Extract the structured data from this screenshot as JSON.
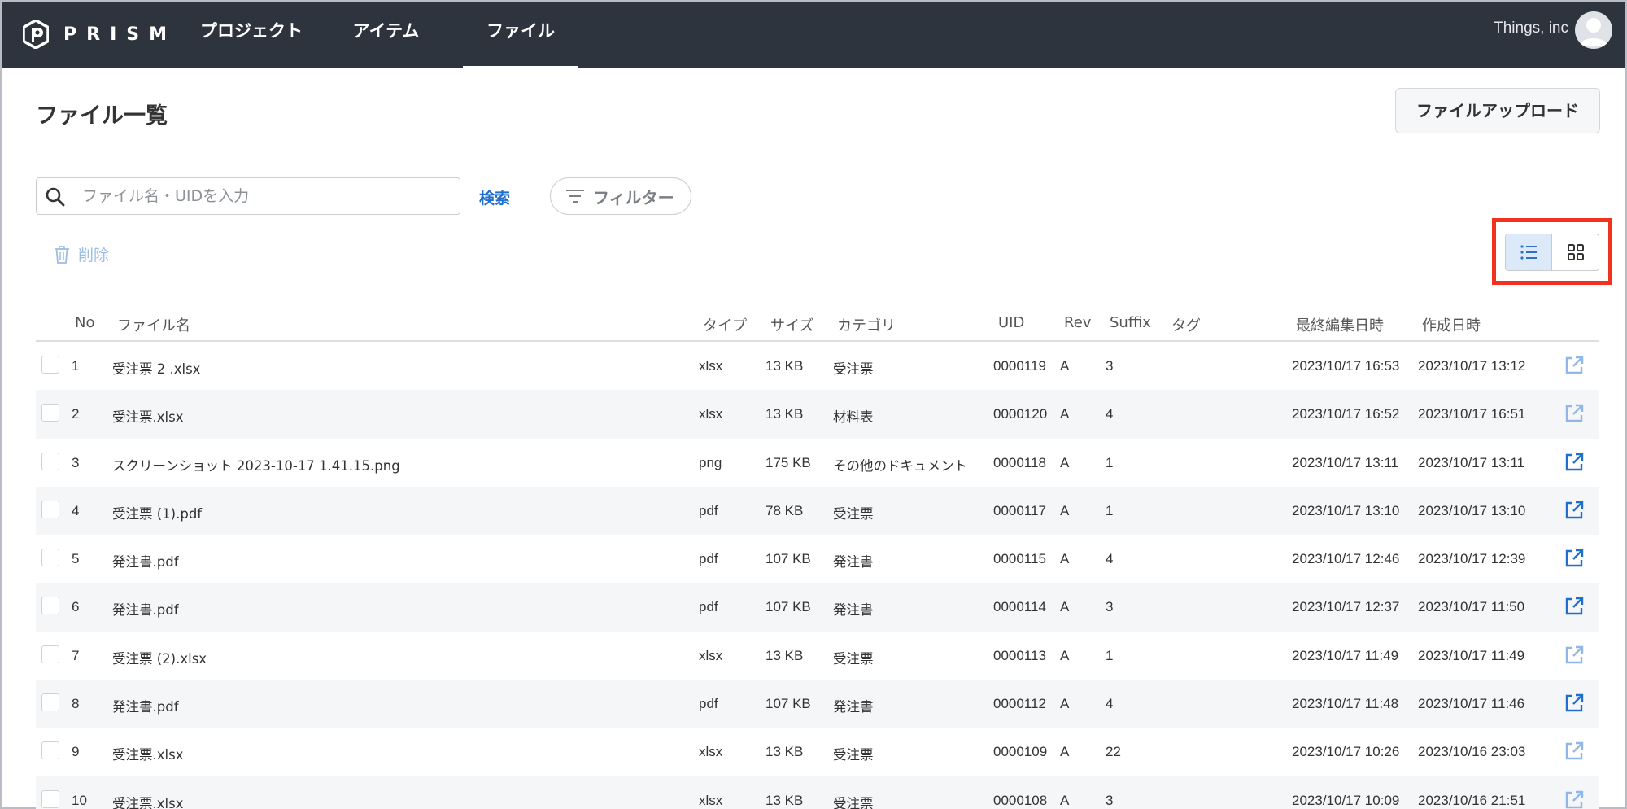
{
  "app": {
    "logo_text": "PRISM",
    "org_name": "Things, inc"
  },
  "nav": {
    "items": [
      {
        "label": "プロジェクト",
        "active": false
      },
      {
        "label": "アイテム",
        "active": false
      },
      {
        "label": "ファイル",
        "active": true
      }
    ]
  },
  "page": {
    "title": "ファイル一覧",
    "upload_label": "ファイルアップロード"
  },
  "search": {
    "placeholder": "ファイル名・UIDを入力",
    "value": "",
    "button_label": "検索",
    "filter_label": "フィルター"
  },
  "actions": {
    "delete_label": "削除"
  },
  "view_toggle": {
    "active": "list",
    "options": [
      "list-icon",
      "grid-icon"
    ]
  },
  "colors": {
    "nav_bg": "#2e343d",
    "accent": "#1f6fd0",
    "highlight": "#f0321e",
    "link_active": "#1f6fd0",
    "link_faded": "#8fb8e8"
  },
  "table": {
    "headers": {
      "no": "No",
      "name": "ファイル名",
      "type": "タイプ",
      "size": "サイズ",
      "category": "カテゴリ",
      "uid": "UID",
      "rev": "Rev",
      "suffix": "Suffix",
      "tag": "タグ",
      "updated": "最終編集日時",
      "created": "作成日時"
    },
    "rows": [
      {
        "no": "1",
        "name": "受注票 2 .xlsx",
        "type": "xlsx",
        "size": "13 KB",
        "category": "受注票",
        "uid": "0000119",
        "rev": "A",
        "suffix": "3",
        "tag": "",
        "updated": "2023/10/17 16:53",
        "created": "2023/10/17 13:12",
        "link_faded": true
      },
      {
        "no": "2",
        "name": "受注票.xlsx",
        "type": "xlsx",
        "size": "13 KB",
        "category": "材料表",
        "uid": "0000120",
        "rev": "A",
        "suffix": "4",
        "tag": "",
        "updated": "2023/10/17 16:52",
        "created": "2023/10/17 16:51",
        "link_faded": true
      },
      {
        "no": "3",
        "name": "スクリーンショット 2023-10-17 1.41.15.png",
        "type": "png",
        "size": "175 KB",
        "category": "その他のドキュメント",
        "uid": "0000118",
        "rev": "A",
        "suffix": "1",
        "tag": "",
        "updated": "2023/10/17 13:11",
        "created": "2023/10/17 13:11",
        "link_faded": false
      },
      {
        "no": "4",
        "name": "受注票 (1).pdf",
        "type": "pdf",
        "size": "78 KB",
        "category": "受注票",
        "uid": "0000117",
        "rev": "A",
        "suffix": "1",
        "tag": "",
        "updated": "2023/10/17 13:10",
        "created": "2023/10/17 13:10",
        "link_faded": false
      },
      {
        "no": "5",
        "name": "発注書.pdf",
        "type": "pdf",
        "size": "107 KB",
        "category": "発注書",
        "uid": "0000115",
        "rev": "A",
        "suffix": "4",
        "tag": "",
        "updated": "2023/10/17 12:46",
        "created": "2023/10/17 12:39",
        "link_faded": false
      },
      {
        "no": "6",
        "name": "発注書.pdf",
        "type": "pdf",
        "size": "107 KB",
        "category": "発注書",
        "uid": "0000114",
        "rev": "A",
        "suffix": "3",
        "tag": "",
        "updated": "2023/10/17 12:37",
        "created": "2023/10/17 11:50",
        "link_faded": false
      },
      {
        "no": "7",
        "name": "受注票 (2).xlsx",
        "type": "xlsx",
        "size": "13 KB",
        "category": "受注票",
        "uid": "0000113",
        "rev": "A",
        "suffix": "1",
        "tag": "",
        "updated": "2023/10/17 11:49",
        "created": "2023/10/17 11:49",
        "link_faded": true
      },
      {
        "no": "8",
        "name": "発注書.pdf",
        "type": "pdf",
        "size": "107 KB",
        "category": "発注書",
        "uid": "0000112",
        "rev": "A",
        "suffix": "4",
        "tag": "",
        "updated": "2023/10/17 11:48",
        "created": "2023/10/17 11:46",
        "link_faded": false
      },
      {
        "no": "9",
        "name": "受注票.xlsx",
        "type": "xlsx",
        "size": "13 KB",
        "category": "受注票",
        "uid": "0000109",
        "rev": "A",
        "suffix": "22",
        "tag": "",
        "updated": "2023/10/17 10:26",
        "created": "2023/10/16 23:03",
        "link_faded": true
      },
      {
        "no": "10",
        "name": "受注票.xlsx",
        "type": "xlsx",
        "size": "13 KB",
        "category": "受注票",
        "uid": "0000108",
        "rev": "A",
        "suffix": "3",
        "tag": "",
        "updated": "2023/10/17 10:09",
        "created": "2023/10/16 21:51",
        "link_faded": true
      }
    ]
  }
}
